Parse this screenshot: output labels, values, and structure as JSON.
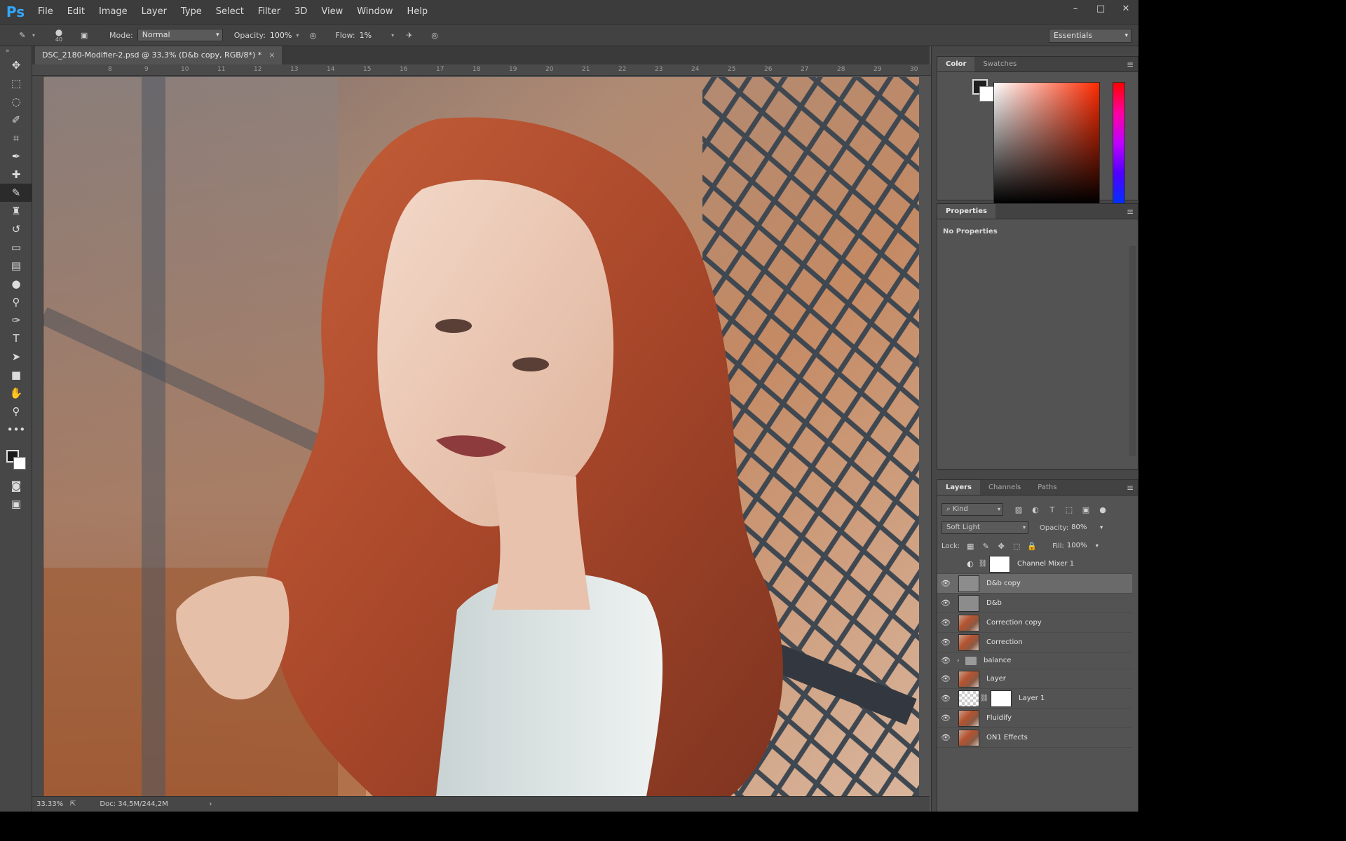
{
  "menubar": {
    "logo": "Ps",
    "items": [
      "File",
      "Edit",
      "Image",
      "Layer",
      "Type",
      "Select",
      "Filter",
      "3D",
      "View",
      "Window",
      "Help"
    ]
  },
  "window_controls": {
    "minimize": "–",
    "maximize": "□",
    "close": "✕"
  },
  "options": {
    "brush_size": "40",
    "mode_label": "Mode:",
    "mode_value": "Normal",
    "opacity_label": "Opacity:",
    "opacity_value": "100%",
    "flow_label": "Flow:",
    "flow_value": "1%",
    "workspace": "Essentials"
  },
  "document": {
    "tab_title": "DSC_2180-Modifier-2.psd @ 33,3% (D&b copy, RGB/8*) *",
    "tab_close": "×"
  },
  "rulers": {
    "top": [
      "8",
      "9",
      "10",
      "11",
      "12",
      "13",
      "14",
      "15",
      "16",
      "17",
      "18",
      "19",
      "20",
      "21",
      "22",
      "23",
      "24",
      "25",
      "26",
      "27",
      "28",
      "29",
      "30"
    ]
  },
  "status": {
    "zoom": "33.33%",
    "doc": "Doc: 34,5M/244,2M",
    "arrow": "›"
  },
  "panels": {
    "color_tabs": [
      "Color",
      "Swatches"
    ],
    "properties_tab": "Properties",
    "properties_empty": "No Properties",
    "layers_tabs": [
      "Layers",
      "Channels",
      "Paths"
    ]
  },
  "layers_panel": {
    "kind": "Kind",
    "blend_mode": "Soft Light",
    "opacity_label": "Opacity:",
    "opacity_value": "80%",
    "lock_label": "Lock:",
    "fill_label": "Fill:",
    "fill_value": "100%"
  },
  "layers": [
    {
      "name": "Channel Mixer 1",
      "visible": false,
      "type": "adjustment"
    },
    {
      "name": "D&b copy",
      "visible": true,
      "type": "gray",
      "selected": true
    },
    {
      "name": "D&b",
      "visible": true,
      "type": "gray"
    },
    {
      "name": "Correction copy",
      "visible": true,
      "type": "photo"
    },
    {
      "name": "Correction",
      "visible": true,
      "type": "photo"
    },
    {
      "name": "balance",
      "visible": true,
      "type": "group"
    },
    {
      "name": "Layer",
      "visible": true,
      "type": "photo"
    },
    {
      "name": "Layer 1",
      "visible": true,
      "type": "masked"
    },
    {
      "name": "Fluidify",
      "visible": true,
      "type": "photo"
    },
    {
      "name": "ON1 Effects",
      "visible": true,
      "type": "photo"
    }
  ],
  "colors": {
    "app_bg": "#535353",
    "accent": "#31a8ff",
    "selected_layer": "#6a6a6a"
  }
}
